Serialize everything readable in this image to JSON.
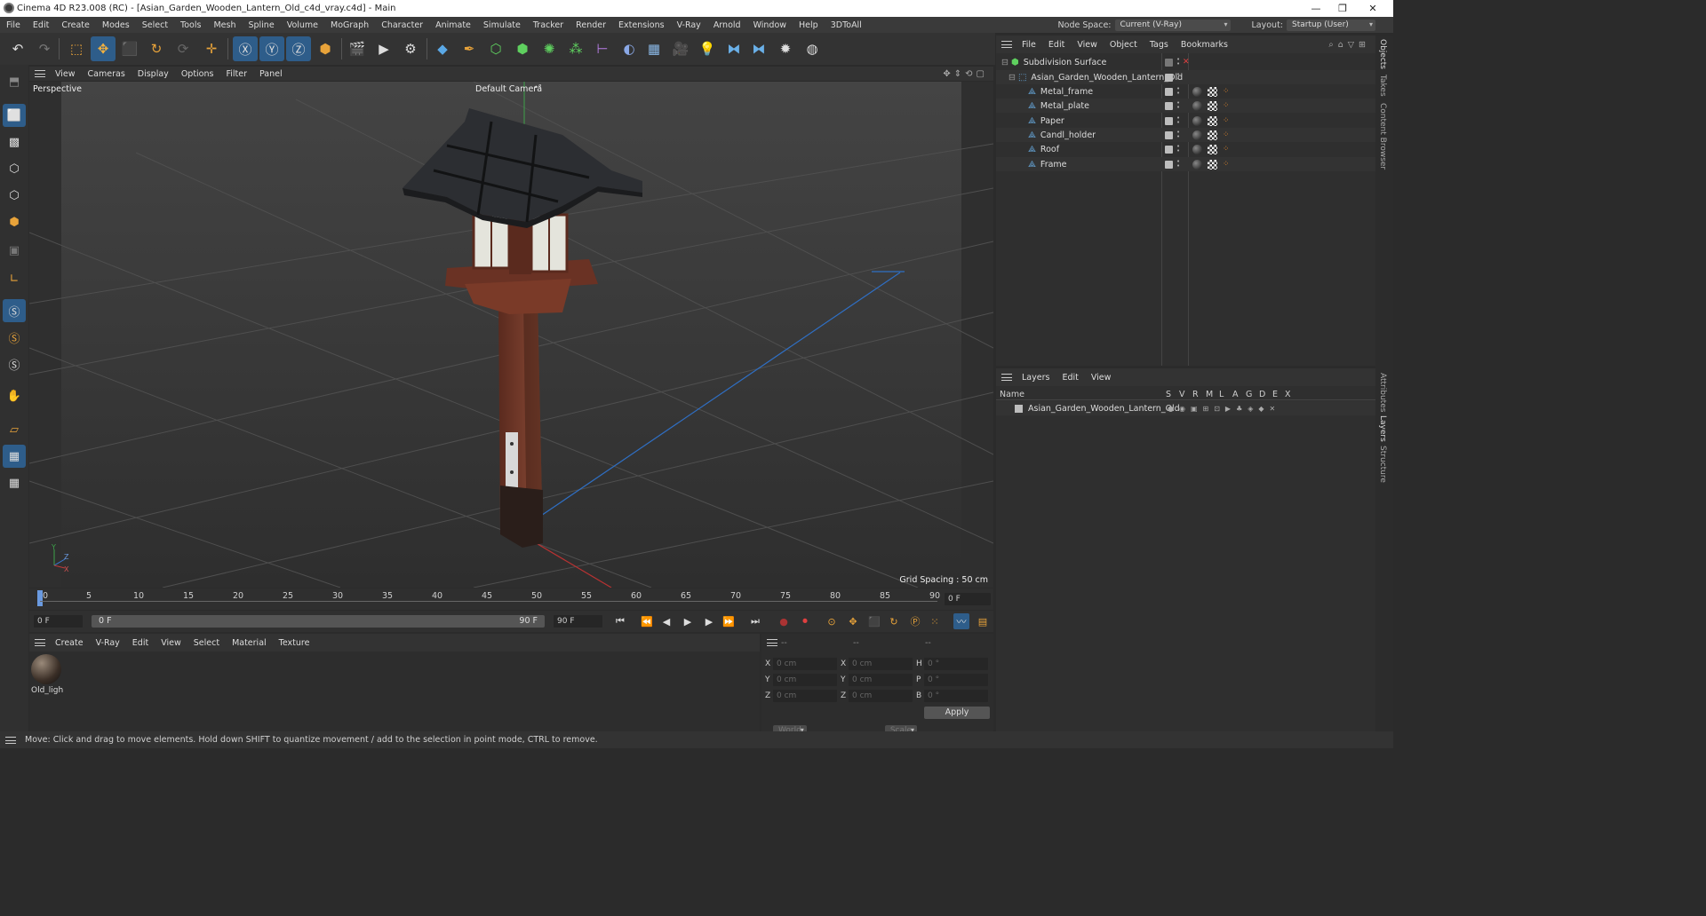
{
  "window": {
    "title": "Cinema 4D R23.008 (RC) - [Asian_Garden_Wooden_Lantern_Old_c4d_vray.c4d] - Main",
    "minimize": "—",
    "maximize": "❐",
    "close": "✕"
  },
  "menu": {
    "items": [
      "File",
      "Edit",
      "Create",
      "Modes",
      "Select",
      "Tools",
      "Mesh",
      "Spline",
      "Volume",
      "MoGraph",
      "Character",
      "Animate",
      "Simulate",
      "Tracker",
      "Render",
      "Extensions",
      "V-Ray",
      "Arnold",
      "Window",
      "Help",
      "3DToAll"
    ],
    "node_space_label": "Node Space:",
    "node_space_value": "Current (V-Ray)",
    "layout_label": "Layout:",
    "layout_value": "Startup (User)"
  },
  "viewport": {
    "menu": [
      "View",
      "Cameras",
      "Display",
      "Options",
      "Filter",
      "Panel"
    ],
    "view_name": "Perspective",
    "camera": "Default Camera",
    "camera_mark": "•°",
    "grid_spacing": "Grid Spacing : 50 cm",
    "axis_y": "Y",
    "axis_z": "Z",
    "axis_x": "X"
  },
  "timeline": {
    "ticks": [
      "0",
      "5",
      "10",
      "15",
      "20",
      "25",
      "30",
      "35",
      "40",
      "45",
      "50",
      "55",
      "60",
      "65",
      "70",
      "75",
      "80",
      "85",
      "90"
    ],
    "current_frame": "0 F"
  },
  "transport": {
    "start": "0 F",
    "range_start": "0 F",
    "range_end": "90 F",
    "end": "90 F"
  },
  "materials": {
    "menu": [
      "Create",
      "V-Ray",
      "Edit",
      "View",
      "Select",
      "Material",
      "Texture"
    ],
    "items": [
      {
        "name": "Old_ligh"
      }
    ]
  },
  "coords": {
    "header": [
      "--",
      "--",
      "--"
    ],
    "rows": [
      {
        "a": "X",
        "av": "0 cm",
        "b": "X",
        "bv": "0 cm",
        "c": "H",
        "cv": "0 °"
      },
      {
        "a": "Y",
        "av": "0 cm",
        "b": "Y",
        "bv": "0 cm",
        "c": "P",
        "cv": "0 °"
      },
      {
        "a": "Z",
        "av": "0 cm",
        "b": "Z",
        "bv": "0 cm",
        "c": "B",
        "cv": "0 °"
      }
    ],
    "mode1": "World",
    "mode2": "Scale",
    "apply": "Apply"
  },
  "status": "Move: Click and drag to move elements. Hold down SHIFT to quantize movement / add to the selection in point mode, CTRL to remove.",
  "objects": {
    "menu": [
      "File",
      "Edit",
      "View",
      "Object",
      "Tags",
      "Bookmarks"
    ],
    "root": "Subdivision Surface",
    "group": "Asian_Garden_Wooden_Lantern_Old",
    "children": [
      "Metal_frame",
      "Metal_plate",
      "Paper",
      "Candl_holder",
      "Roof",
      "Frame"
    ]
  },
  "layers": {
    "menu": [
      "Layers",
      "Edit",
      "View"
    ],
    "col_name": "Name",
    "cols": [
      "S",
      "V",
      "R",
      "M",
      "L",
      "A",
      "G",
      "D",
      "E",
      "X"
    ],
    "items": [
      "Asian_Garden_Wooden_Lantern_Old"
    ]
  },
  "side_tabs": [
    "Objects",
    "Takes",
    "Content Browser",
    "Attributes",
    "Layers",
    "Structure"
  ]
}
